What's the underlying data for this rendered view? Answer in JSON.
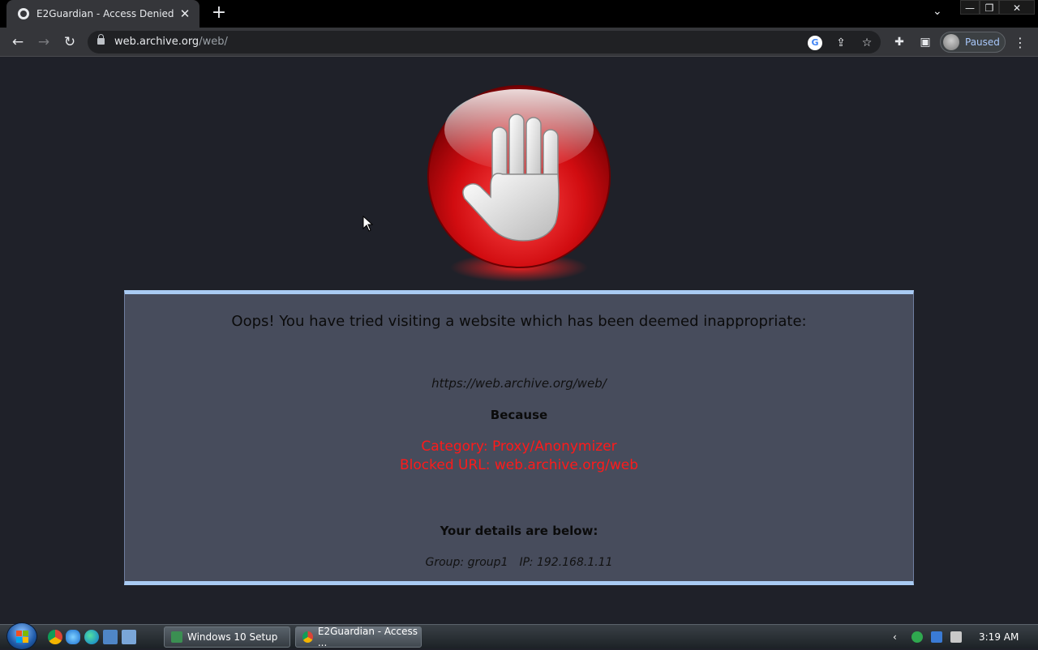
{
  "browser": {
    "tab_title": "E2Guardian - Access Denied",
    "url_host": "web.archive.org",
    "url_path": "/web/",
    "profile_status": "Paused"
  },
  "page": {
    "headline": "Oops! You have tried visiting a website which has been deemed inappropriate:",
    "blocked_url": "https://web.archive.org/web/",
    "because": "Because",
    "reason_category": "Category: Proxy/Anonymizer",
    "reason_blocked": "Blocked URL: web.archive.org/web",
    "details_heading": "Your details are below:",
    "group": "Group: group1",
    "ip": "IP: 192.168.1.11"
  },
  "taskbar": {
    "tasks": [
      {
        "label": "Windows 10 Setup"
      },
      {
        "label": "E2Guardian - Access ..."
      }
    ],
    "clock": "3:19 AM"
  },
  "colors": {
    "page_background": "#1f2129",
    "panel_background": "#474c5c",
    "panel_border": "#a9cbf3",
    "reason_text": "#ff1a1a"
  }
}
